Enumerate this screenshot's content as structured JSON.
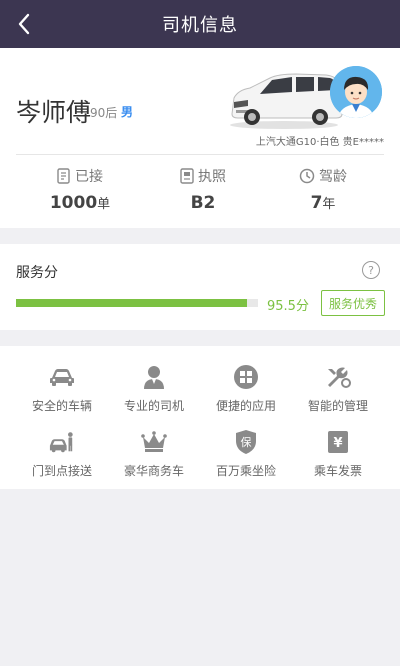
{
  "nav": {
    "title": "司机信息",
    "back_icon": "chevron-left-icon"
  },
  "driver": {
    "name": "岑师傅",
    "age_group": "90后",
    "gender": "男"
  },
  "car": {
    "info": "上汽大通G10·白色  贵E*****"
  },
  "stats": [
    {
      "label": "已接",
      "value": "1000",
      "unit": "单",
      "icon": "order-doc-icon"
    },
    {
      "label": "执照",
      "value": "B2",
      "unit": "",
      "icon": "license-card-icon"
    },
    {
      "label": "驾龄",
      "value": "7",
      "unit": "年",
      "icon": "clock-icon"
    }
  ],
  "score": {
    "label": "服务分",
    "value_text": "95.5分",
    "value": 95.5,
    "max": 100,
    "badge": "服务优秀",
    "help": "?"
  },
  "features": [
    {
      "label": "安全的车辆",
      "icon": "car-icon"
    },
    {
      "label": "专业的司机",
      "icon": "driver-icon"
    },
    {
      "label": "便捷的应用",
      "icon": "app-grid-icon"
    },
    {
      "label": "智能的管理",
      "icon": "wrench-icon"
    },
    {
      "label": "门到点接送",
      "icon": "door-pickup-icon"
    },
    {
      "label": "豪华商务车",
      "icon": "crown-icon"
    },
    {
      "label": "百万乘坐险",
      "icon": "insurance-shield-icon",
      "glyph": "保"
    },
    {
      "label": "乘车发票",
      "icon": "invoice-icon",
      "glyph": "¥"
    }
  ],
  "colors": {
    "nav_bg": "#3c3651",
    "accent_green": "#7cc142",
    "gender_blue": "#3a8ef0",
    "icon_gray": "#8a8a8a"
  }
}
